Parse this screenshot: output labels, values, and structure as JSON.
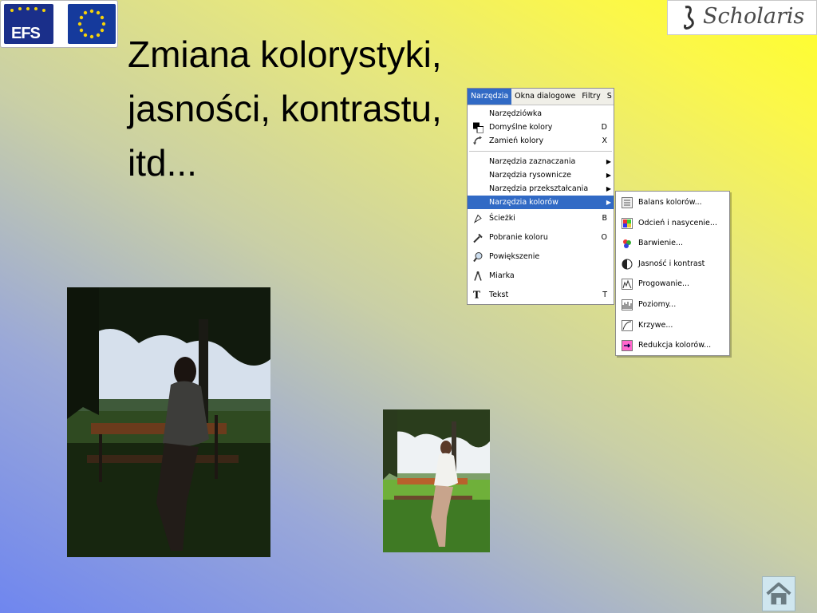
{
  "logos": {
    "efs_text": "EFS",
    "scholaris_text": "Scholaris"
  },
  "title": "Zmiana kolorystyki, jasności, kontrastu, itd...",
  "menubar": {
    "items": [
      "Narzędzia",
      "Okna dialogowe",
      "Filtry",
      "S"
    ],
    "active_index": 0
  },
  "tools_menu": {
    "items": [
      {
        "label": "Narzędziówka",
        "shortcut": "",
        "icon": "none"
      },
      {
        "label": "Domyślne kolory",
        "shortcut": "D",
        "icon": "default-colors-icon"
      },
      {
        "label": "Zamień kolory",
        "shortcut": "X",
        "icon": "swap-colors-icon"
      },
      {
        "label": "Narzędzia zaznaczania",
        "submenu": true
      },
      {
        "label": "Narzędzia rysownicze",
        "submenu": true
      },
      {
        "label": "Narzędzia przekształcania",
        "submenu": true
      },
      {
        "label": "Narzędzia kolorów",
        "submenu": true,
        "active": true
      },
      {
        "label": "Ścieżki",
        "shortcut": "B",
        "icon": "paths-icon"
      },
      {
        "label": "Pobranie koloru",
        "shortcut": "O",
        "icon": "color-picker-icon"
      },
      {
        "label": "Powiększenie",
        "shortcut": "",
        "icon": "zoom-icon"
      },
      {
        "label": "Miarka",
        "shortcut": "",
        "icon": "measure-icon"
      },
      {
        "label": "Tekst",
        "shortcut": "T",
        "icon": "text-icon"
      }
    ]
  },
  "color_tools_submenu": {
    "items": [
      {
        "label": "Balans kolorów...",
        "icon": "color-balance-icon"
      },
      {
        "label": "Odcień i nasycenie...",
        "icon": "hue-saturation-icon"
      },
      {
        "label": "Barwienie...",
        "icon": "colorize-icon"
      },
      {
        "label": "Jasność i kontrast",
        "icon": "brightness-contrast-icon"
      },
      {
        "label": "Progowanie...",
        "icon": "threshold-icon"
      },
      {
        "label": "Poziomy...",
        "icon": "levels-icon"
      },
      {
        "label": "Krzywe...",
        "icon": "curves-icon"
      },
      {
        "label": "Redukcja kolorów...",
        "icon": "reduce-colors-icon"
      }
    ]
  },
  "colors": {
    "menu_highlight": "#316ac5",
    "gradient_start": "#6f86ef",
    "gradient_end": "#ffff2a"
  },
  "home_button": {
    "icon": "home-icon"
  }
}
